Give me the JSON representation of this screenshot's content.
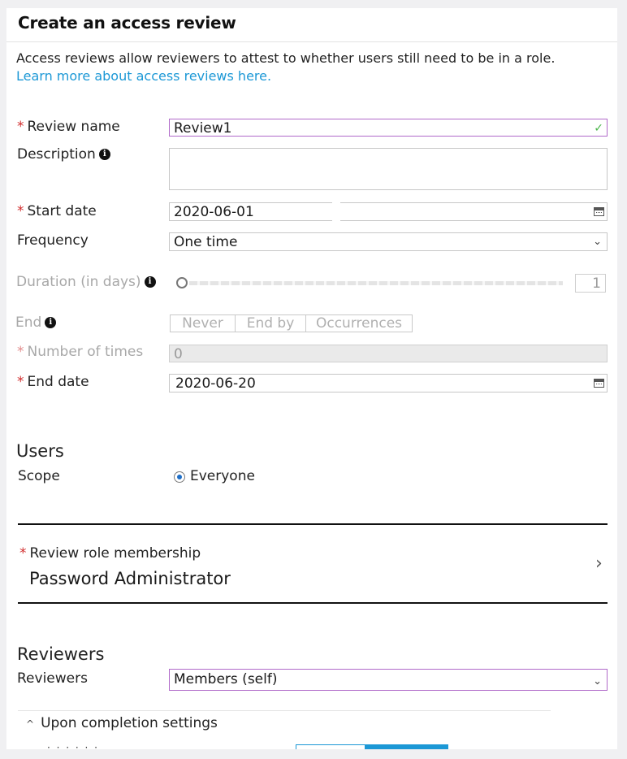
{
  "header": {
    "title": "Create an access review"
  },
  "intro": {
    "text": "Access reviews allow reviewers to attest to whether users still need to be in a role.",
    "link": "Learn more  about access reviews here."
  },
  "form": {
    "review_name": {
      "label": "Review name",
      "value": "Review1"
    },
    "description": {
      "label": "Description",
      "value": ""
    },
    "start_date": {
      "label": "Start date",
      "value": "2020-06-01"
    },
    "frequency": {
      "label": "Frequency",
      "value": "One time"
    },
    "duration": {
      "label": "Duration (in days)",
      "value": "1"
    },
    "end": {
      "label": "End",
      "options": [
        "Never",
        "End by",
        "Occurrences"
      ]
    },
    "number_of_times": {
      "label": "Number of times",
      "value": "0"
    },
    "end_date": {
      "label": "End date",
      "value": "2020-06-20"
    }
  },
  "users": {
    "heading": "Users",
    "scope_label": "Scope",
    "scope_value": "Everyone"
  },
  "role_membership": {
    "label": "Review role membership",
    "value": "Password Administrator"
  },
  "reviewers": {
    "heading": "Reviewers",
    "label": "Reviewers",
    "value": "Members (self)"
  },
  "completion": {
    "label": "Upon completion settings"
  },
  "icons": {
    "info": "info-icon",
    "calendar": "calendar-icon",
    "chevron_down": "chevron-down-icon",
    "chevron_right": "chevron-right-icon",
    "check": "check-icon",
    "caret_up": "caret-up-icon"
  },
  "colors": {
    "link": "#1c98d6",
    "required": "#d12d2d",
    "focus_border": "#b069c9",
    "valid_check": "#4bb64b",
    "radio_selected": "#1f6fc7"
  },
  "duration_slider_fraction": 0
}
